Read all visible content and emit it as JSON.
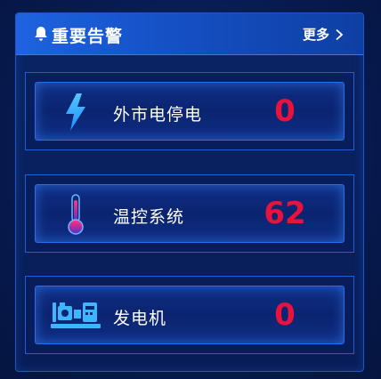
{
  "header": {
    "title": "重要告警",
    "more_label": "更多"
  },
  "alerts": [
    {
      "label": "外市电停电",
      "value": "0",
      "icon": "lightning-icon"
    },
    {
      "label": "温控系统",
      "value": "62",
      "icon": "thermometer-icon"
    },
    {
      "label": "发电机",
      "value": "0",
      "icon": "generator-icon"
    }
  ],
  "colors": {
    "accent": "#1e63e0",
    "value": "#e8123c",
    "icon_blue": "#2ea6ff"
  }
}
